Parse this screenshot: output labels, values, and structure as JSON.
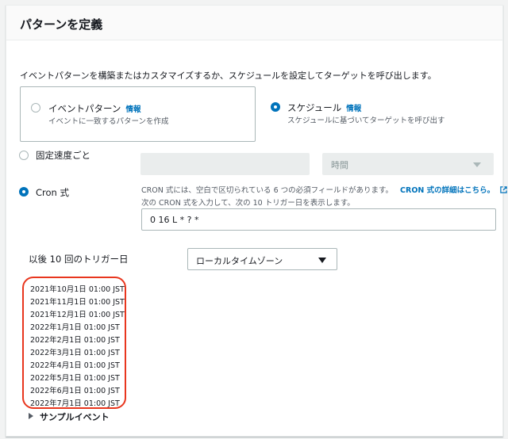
{
  "panel": {
    "title": "パターンを定義",
    "description": "イベントパターンを構築またはカスタマイズするか、スケジュールを設定してターゲットを呼び出します。"
  },
  "options": {
    "event_pattern": {
      "title": "イベントパターン",
      "info": "情報",
      "subtitle": "イベントに一致するパターンを作成",
      "selected": false
    },
    "schedule": {
      "title": "スケジュール",
      "info": "情報",
      "subtitle": "スケジュールに基づいてターゲットを呼び出す",
      "selected": true
    }
  },
  "schedule_type": {
    "fixed_rate_label": "固定速度ごと",
    "fixed_rate_value": "",
    "unit_placeholder": "時間",
    "cron_label": "Cron 式",
    "cron_selected": true,
    "fixed_selected": false
  },
  "cron": {
    "help_line1": "CRON 式には、空白で区切られている 6 つの必須フィールドがあります。",
    "help_link": "CRON 式の詳細はこちら。",
    "help_line2": "次の CRON 式を入力して、次の 10 トリガー日を表示します。",
    "value": "0 16 L * ? *"
  },
  "triggers": {
    "label": "以後 10 回のトリガー日",
    "timezone": "ローカルタイムゾーン",
    "dates": [
      "2021年10月1日 01:00 JST",
      "2021年11月1日 01:00 JST",
      "2021年12月1日 01:00 JST",
      "2022年1月1日 01:00 JST",
      "2022年2月1日 01:00 JST",
      "2022年3月1日 01:00 JST",
      "2022年4月1日 01:00 JST",
      "2022年5月1日 01:00 JST",
      "2022年6月1日 01:00 JST",
      "2022年7月1日 01:00 JST"
    ]
  },
  "sample_event": {
    "label": "サンプルイベント"
  },
  "colors": {
    "accent": "#0073bb",
    "highlight": "#e8361e"
  }
}
